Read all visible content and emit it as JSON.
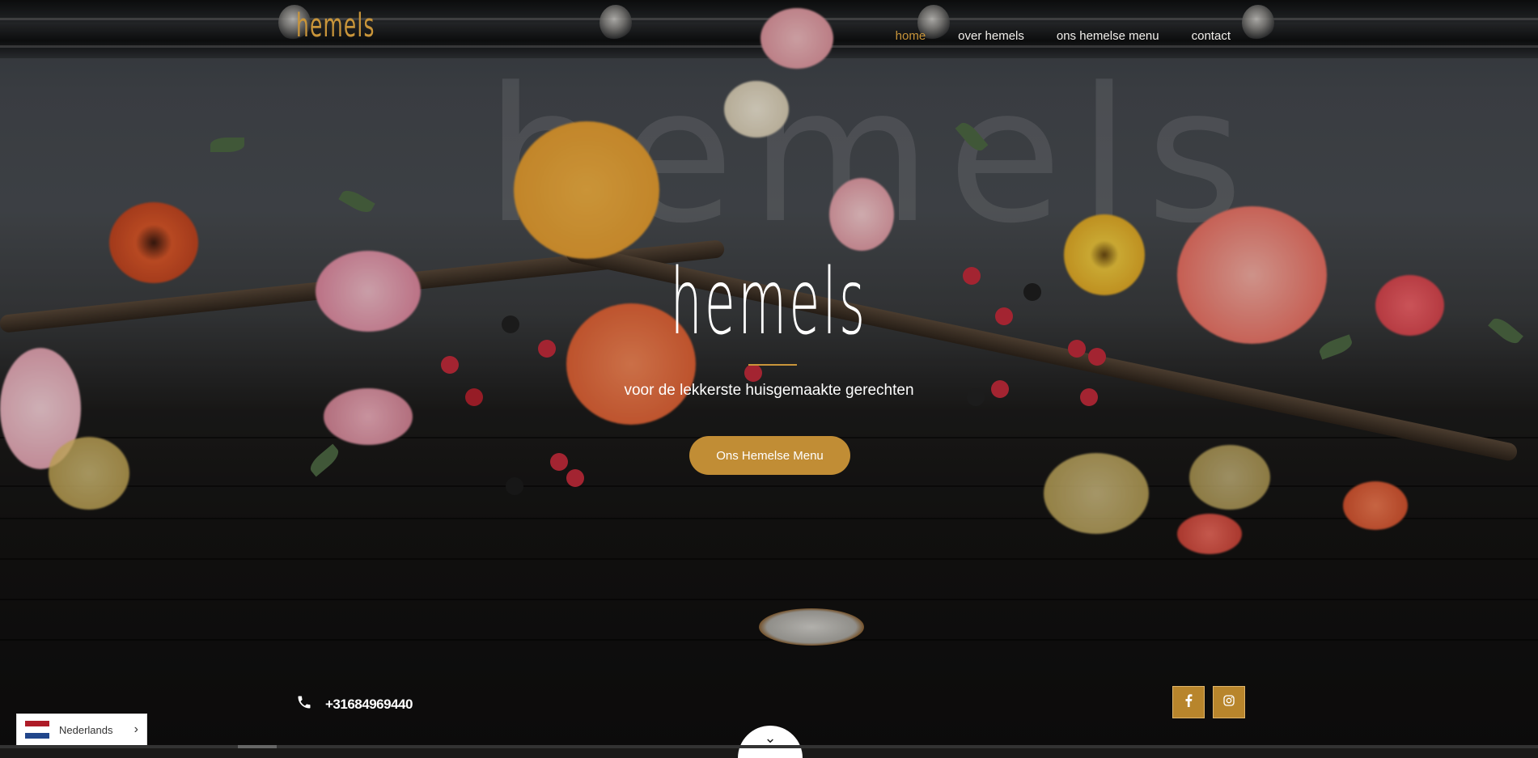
{
  "header": {
    "logo_text": "hemels",
    "nav": [
      {
        "label": "home",
        "active": true
      },
      {
        "label": "over hemels",
        "active": false
      },
      {
        "label": "ons hemelse menu",
        "active": false
      },
      {
        "label": "contact",
        "active": false
      }
    ]
  },
  "hero": {
    "title": "hemels",
    "tagline": "voor de lekkerste huisgemaakte gerechten",
    "cta_label": "Ons Hemelse Menu"
  },
  "contact": {
    "phone_icon": "phone-icon",
    "phone": "+31684969440"
  },
  "social": [
    {
      "icon": "facebook-icon",
      "glyph": "f"
    },
    {
      "icon": "instagram-icon",
      "glyph": ""
    }
  ],
  "language": {
    "label": "Nederlands",
    "flag": "netherlands-flag-icon"
  },
  "colors": {
    "accent": "#c18d35",
    "nav_active": "#c9953a",
    "text": "#ffffff"
  }
}
